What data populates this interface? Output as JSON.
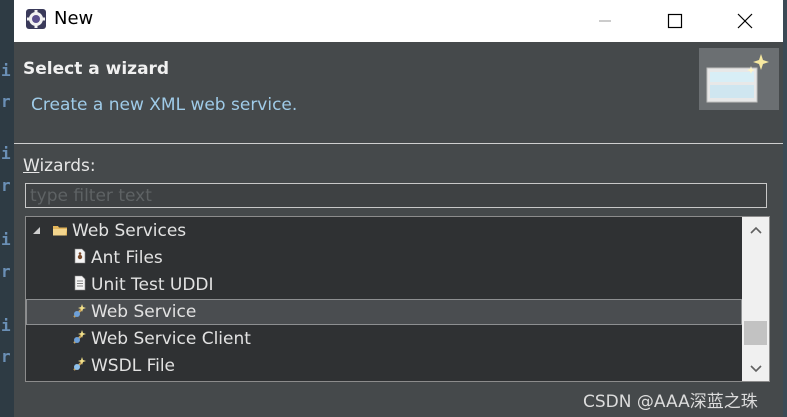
{
  "window": {
    "title": "New"
  },
  "header": {
    "title": "Select a wizard",
    "description": "Create a new XML web service."
  },
  "wizards": {
    "label_prefix": "W",
    "label_rest": "izards:",
    "filter_placeholder": "type filter text",
    "tree": [
      {
        "label": "Web Services",
        "level": 0,
        "expanded": true,
        "icon": "folder-icon"
      },
      {
        "label": "Ant Files",
        "level": 1,
        "icon": "ant-file-icon"
      },
      {
        "label": "Unit Test UDDI",
        "level": 1,
        "icon": "uddi-file-icon"
      },
      {
        "label": "Web Service",
        "level": 1,
        "icon": "web-service-icon",
        "selected": true
      },
      {
        "label": "Web Service Client",
        "level": 1,
        "icon": "web-service-client-icon"
      },
      {
        "label": "WSDL File",
        "level": 1,
        "icon": "wsdl-file-icon"
      }
    ]
  },
  "background_editor": {
    "glyphs": [
      "i",
      "r",
      "i",
      "r",
      "i",
      "r",
      "i",
      "r"
    ]
  },
  "watermark": "CSDN @AAA深蓝之珠",
  "colors": {
    "dialog_bg": "#45494b",
    "description_text": "#9fcbe8",
    "tree_bg": "#2f3133",
    "selection_bg": "#4a4d50"
  }
}
